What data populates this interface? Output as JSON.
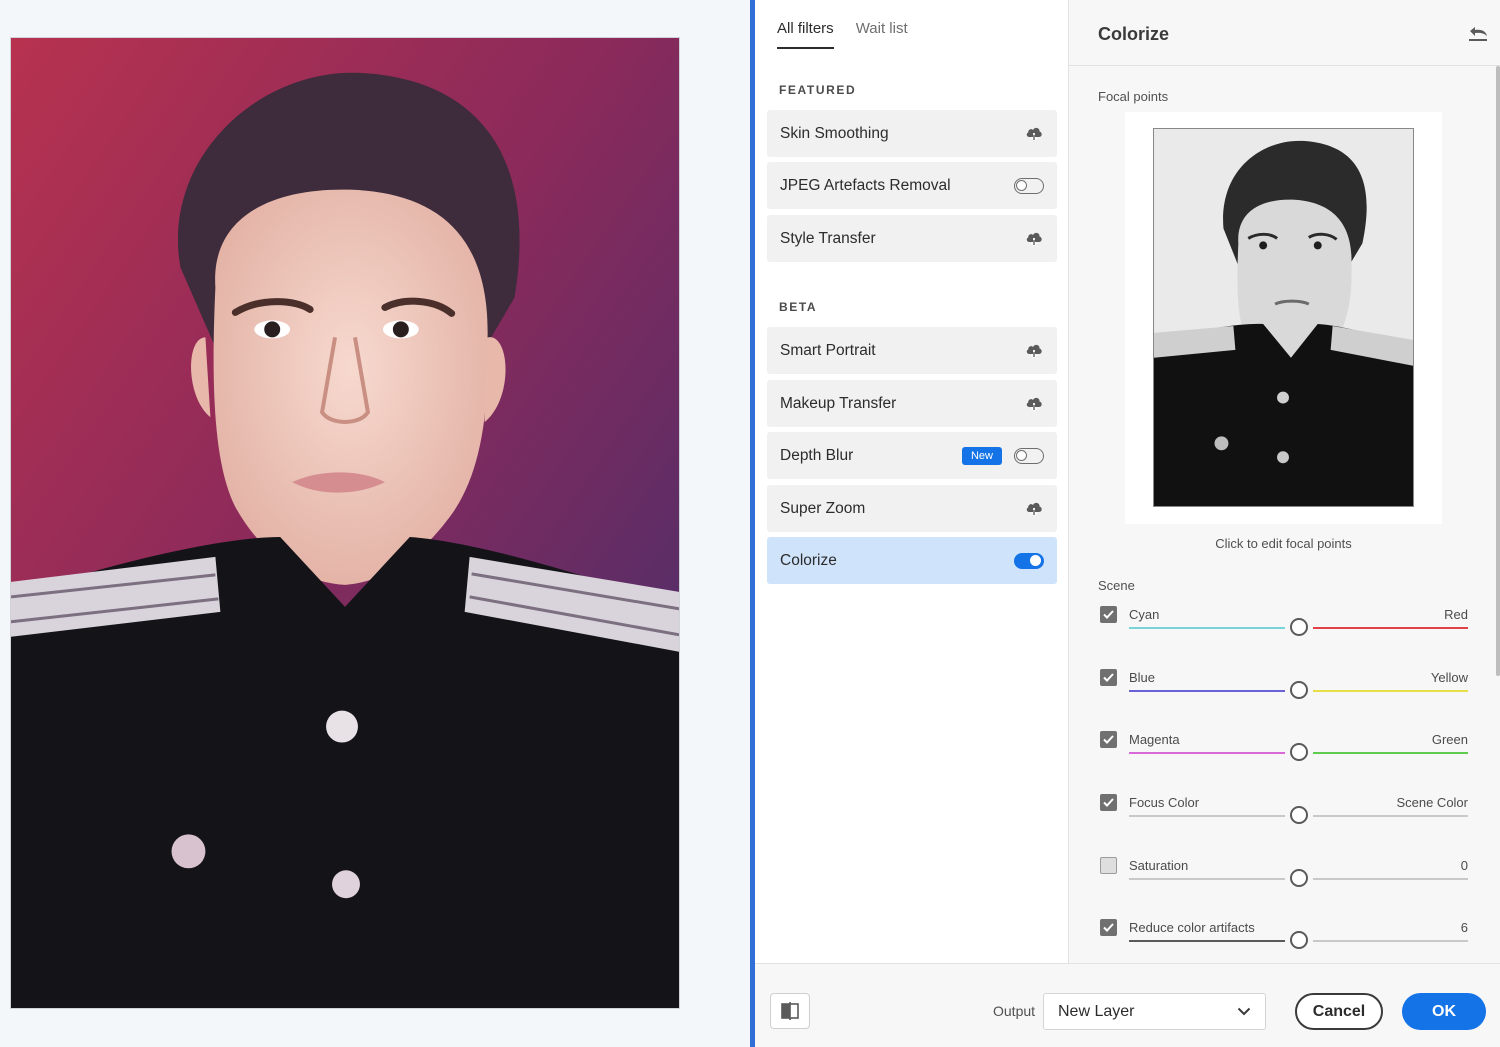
{
  "tabs": [
    {
      "label": "All filters",
      "active": true
    },
    {
      "label": "Wait list",
      "active": false
    }
  ],
  "sections": {
    "featured": "FEATURED",
    "beta": "BETA"
  },
  "filters": {
    "featured": [
      {
        "label": "Skin Smoothing",
        "control": "cloud-download-icon"
      },
      {
        "label": "JPEG Artefacts Removal",
        "control": "toggle",
        "on": false
      },
      {
        "label": "Style Transfer",
        "control": "cloud-download-icon"
      }
    ],
    "beta": [
      {
        "label": "Smart Portrait",
        "control": "cloud-download-icon"
      },
      {
        "label": "Makeup Transfer",
        "control": "cloud-download-icon"
      },
      {
        "label": "Depth Blur",
        "control": "toggle",
        "on": false,
        "badge": "New"
      },
      {
        "label": "Super Zoom",
        "control": "cloud-download-icon"
      },
      {
        "label": "Colorize",
        "control": "toggle",
        "on": true,
        "selected": true
      }
    ]
  },
  "panel": {
    "title": "Colorize",
    "reset_icon": "reset-icon",
    "focal_points_label": "Focal points",
    "focal_hint": "Click to edit focal points",
    "scene_label": "Scene",
    "sliders": [
      {
        "checked": true,
        "left": "Cyan",
        "right": "Red",
        "value": 0.5,
        "colors": [
          "#79d4d8",
          "#e0434a"
        ]
      },
      {
        "checked": true,
        "left": "Blue",
        "right": "Yellow",
        "value": 0.5,
        "colors": [
          "#6a62d6",
          "#e6df4a"
        ]
      },
      {
        "checked": true,
        "left": "Magenta",
        "right": "Green",
        "value": 0.5,
        "colors": [
          "#d86ad8",
          "#5fcc4d"
        ]
      },
      {
        "checked": true,
        "left": "Focus Color",
        "right": "Scene Color",
        "value": 0.5,
        "colors": [
          "#c9c9c9",
          "#c9c9c9"
        ]
      },
      {
        "checked": false,
        "left": "Saturation",
        "right": "0",
        "value": 0.5,
        "colors": [
          "#c9c9c9",
          "#c9c9c9"
        ]
      },
      {
        "checked": true,
        "left": "Reduce color artifacts",
        "right": "6",
        "value": 0.5,
        "colors": [
          "#5a5a5a",
          "#c9c9c9"
        ]
      }
    ]
  },
  "footer": {
    "compare_icon": "before-after-compare-icon",
    "output_label": "Output",
    "output_value": "New Layer",
    "cancel_label": "Cancel",
    "ok_label": "OK"
  },
  "colors": {
    "accent": "#1473e6",
    "selected_row": "#cfe3fb",
    "row_background": "#f1f1f1",
    "divider": "#2f6fd6"
  }
}
